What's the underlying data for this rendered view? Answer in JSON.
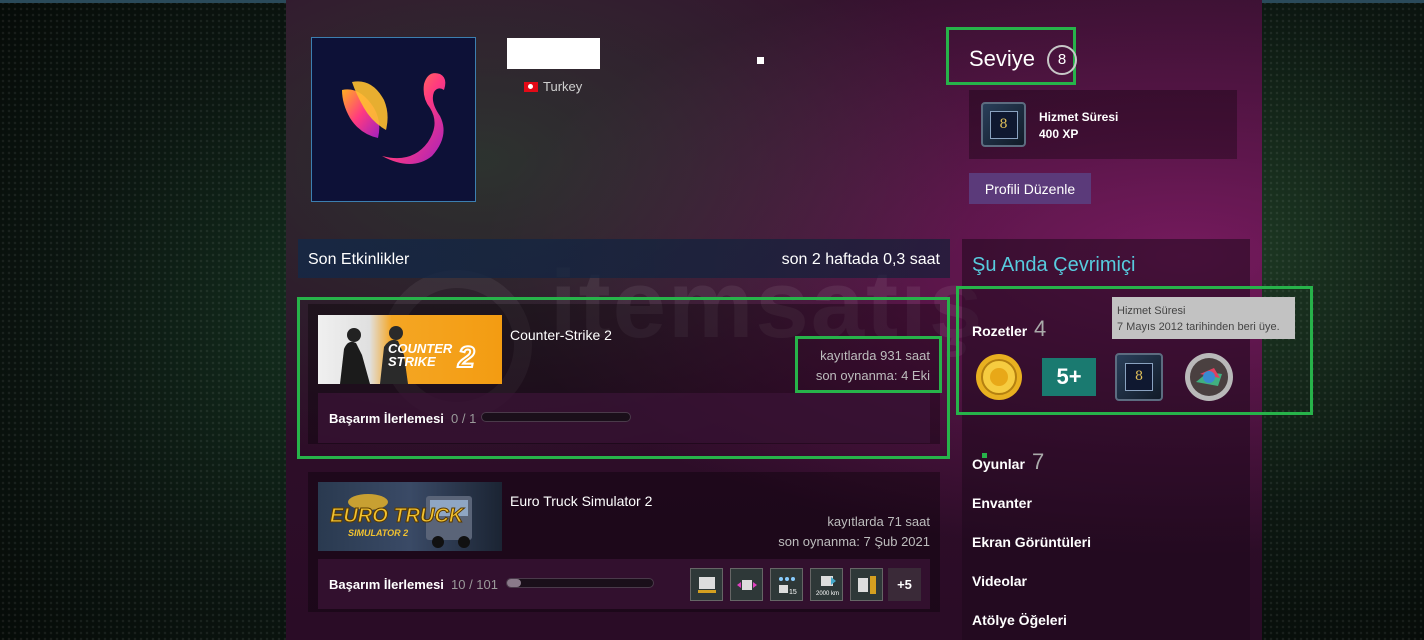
{
  "profile": {
    "country": "Turkey",
    "level_label": "Seviye",
    "level": "8",
    "xp_badge_name": "Hizmet Süresi",
    "xp_value": "400 XP",
    "xp_badge_glyph": "8",
    "edit_button": "Profili Düzenle"
  },
  "activity": {
    "title": "Son Etkinlikler",
    "hours_summary": "son 2 haftada 0,3 saat",
    "games": [
      {
        "name": "Counter-Strike 2",
        "hours": "kayıtlarda 931 saat",
        "last_played": "son oynanma: 4 Eki",
        "achievement_label": "Başarım İlerlemesi",
        "achievement_count": "0 / 1",
        "achievement_progress": 0,
        "logo_text": "COUNTER STRIKE 2"
      },
      {
        "name": "Euro Truck Simulator 2",
        "hours": "kayıtlarda 71 saat",
        "last_played": "son oynanma: 7 Şub 2021",
        "achievement_label": "Başarım İlerlemesi",
        "achievement_count": "10 / 101",
        "achievement_progress": 0.099,
        "logo_text": "EURO TRUCK",
        "logo_subtext": "SIMULATOR 2",
        "more_achievements": "+5"
      }
    ]
  },
  "sidebar": {
    "online_status": "Şu Anda Çevrimiçi",
    "badges_label": "Rozetler",
    "badges_count": "4",
    "badge_5plus": "5+",
    "badge_glyph": "8",
    "tooltip_title": "Hizmet Süresi",
    "tooltip_text": "7 Mayıs 2012 tarihinden beri üye.",
    "games_label": "Oyunlar",
    "games_count": "7",
    "links": [
      "Envanter",
      "Ekran Görüntüleri",
      "Videolar",
      "Atölye Öğeleri"
    ]
  },
  "watermark": "itemsatış",
  "colors": {
    "highlight": "#27b34a",
    "online": "#57cbde",
    "edit_button": "#5b3a7a"
  }
}
